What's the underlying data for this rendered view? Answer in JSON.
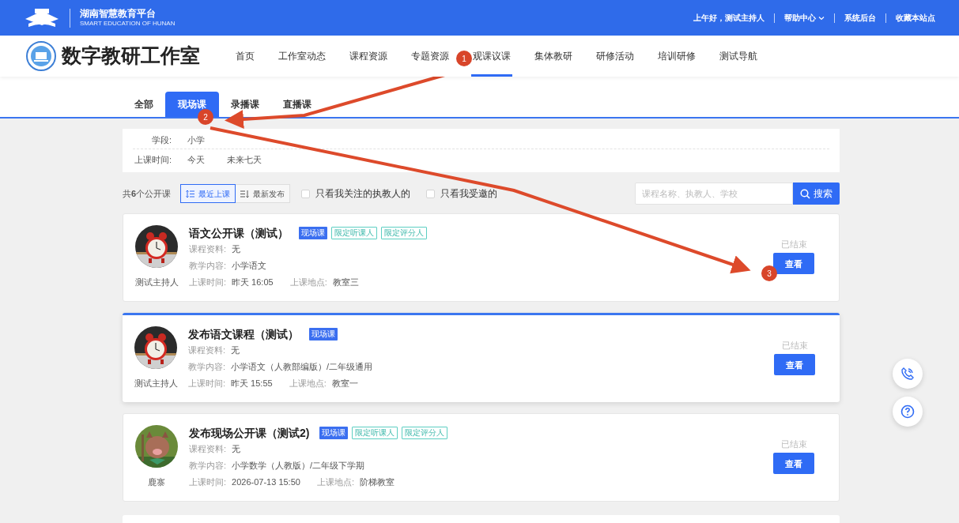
{
  "top_bar": {
    "platform_title": "湖南智慧教育平台",
    "platform_subtitle": "SMART EDUCATION OF HUNAN",
    "greeting": "上午好，测试主持人",
    "links": [
      {
        "label": "帮助中心",
        "dropdown": true
      },
      {
        "label": "系统后台",
        "dropdown": false
      },
      {
        "label": "收藏本站点",
        "dropdown": false
      }
    ]
  },
  "site_title": "数字教研工作室",
  "nav": [
    {
      "label": "首页",
      "selected": false
    },
    {
      "label": "工作室动态",
      "selected": false
    },
    {
      "label": "课程资源",
      "selected": false
    },
    {
      "label": "专题资源",
      "selected": false
    },
    {
      "label": "观课议课",
      "selected": true
    },
    {
      "label": "集体教研",
      "selected": false
    },
    {
      "label": "研修活动",
      "selected": false
    },
    {
      "label": "培训研修",
      "selected": false
    },
    {
      "label": "测试导航",
      "selected": false
    }
  ],
  "tabs": [
    {
      "label": "全部",
      "selected": false
    },
    {
      "label": "现场课",
      "selected": true
    },
    {
      "label": "录播课",
      "selected": false
    },
    {
      "label": "直播课",
      "selected": false
    }
  ],
  "filters": [
    {
      "label": "学段:",
      "options": [
        "小学"
      ]
    },
    {
      "label": "上课时间:",
      "options": [
        "今天",
        "未来七天"
      ]
    }
  ],
  "toolbar": {
    "count": "共**6**个公开课",
    "sorts": [
      {
        "label": "最近上课",
        "selected": true
      },
      {
        "label": "最新发布",
        "selected": false
      }
    ],
    "checkboxes": [
      {
        "label": "只看我关注的执教人的",
        "checked": false
      },
      {
        "label": "只看我受邀的",
        "checked": false
      }
    ],
    "search": {
      "placeholder": "课程名称、执教人、学校",
      "button": "搜索"
    }
  },
  "courses": [
    {
      "title": "语文公开课（测试）",
      "teacher": "测试主持人",
      "highlighted": false,
      "tags": [
        {
          "label": "现场课",
          "kind": "filled"
        },
        {
          "label": "限定听课人",
          "kind": "outline"
        },
        {
          "label": "限定评分人",
          "kind": "outline"
        }
      ],
      "material_label": "课程资料:",
      "material": "无",
      "content_label": "教学内容:",
      "content": "小学语文",
      "time_label": "上课时间:",
      "time": "昨天 16:05",
      "place_label": "上课地点:",
      "place": "教室三",
      "status": "已结束",
      "button": "查看"
    },
    {
      "title": "发布语文课程（测试）",
      "teacher": "测试主持人",
      "highlighted": true,
      "tags": [
        {
          "label": "现场课",
          "kind": "filled"
        }
      ],
      "material_label": "课程资料:",
      "material": "无",
      "content_label": "教学内容:",
      "content": "小学语文（人教部编版）/二年级通用",
      "time_label": "上课时间:",
      "time": "昨天 15:55",
      "place_label": "上课地点:",
      "place": "教室一",
      "status": "已结束",
      "button": "查看"
    },
    {
      "title": "发布现场公开课（测试2)",
      "teacher": "鹿寨",
      "highlighted": false,
      "tags": [
        {
          "label": "现场课",
          "kind": "filled"
        },
        {
          "label": "限定听课人",
          "kind": "outline"
        },
        {
          "label": "限定评分人",
          "kind": "outline"
        }
      ],
      "material_label": "课程资料:",
      "material": "无",
      "content_label": "教学内容:",
      "content": "小学数学（人教版）/二年级下学期",
      "time_label": "上课时间:",
      "time": "2026-07-13 15:50",
      "place_label": "上课地点:",
      "place": "阶梯教室",
      "status": "已结束",
      "button": "查看"
    }
  ],
  "annotations": [
    {
      "number": "1"
    },
    {
      "number": "2"
    },
    {
      "number": "3"
    }
  ]
}
